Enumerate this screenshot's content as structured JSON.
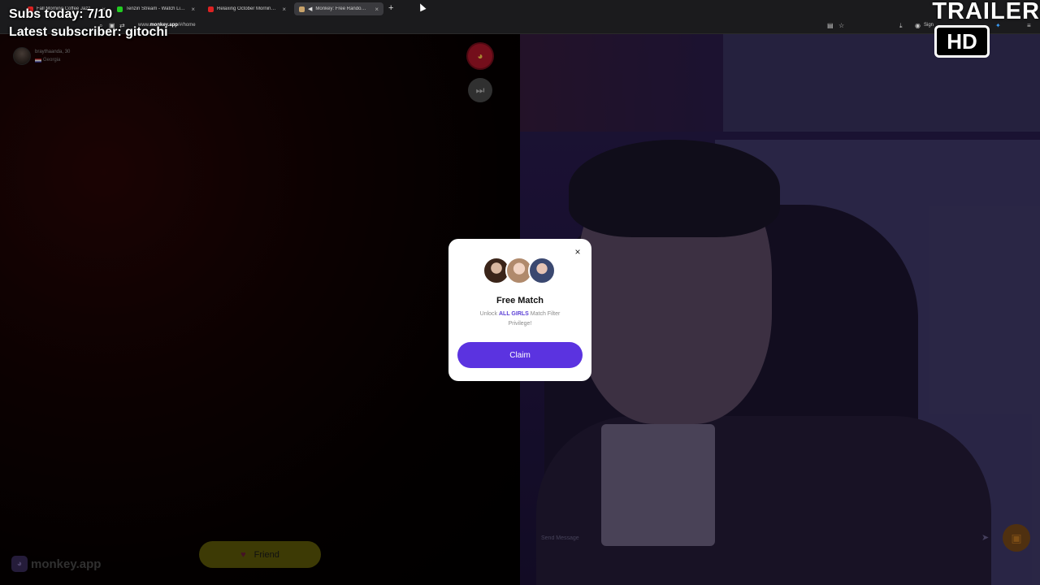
{
  "browser": {
    "tabs": [
      {
        "title": "Fall Morning Coffee Jazz Music",
        "color": "#d22"
      },
      {
        "title": "Tenzin Stream - Watch Live on",
        "color": "#2c2"
      },
      {
        "title": "Relaxing October Morning Jazz",
        "color": "#d22"
      },
      {
        "title": "Monkey: Free Random Vid-",
        "color": "#c9a36a"
      }
    ],
    "new_tab": "+",
    "close_glyph": "×",
    "url_host": "monkey.app",
    "url_path": "/#/home",
    "url_prefix": "www.",
    "sign_in": "Sign"
  },
  "overlay": {
    "subs": "Subs today: 7/10",
    "latest": "Latest subscriber: gitochi",
    "trailer": "TRAILER",
    "hd": "HD"
  },
  "partner": {
    "name": "braythaanda, 30",
    "location": "Georgia"
  },
  "app": {
    "brand": "monkey.app",
    "friend_label": "Friend",
    "message_placeholder": "Send Message"
  },
  "modal": {
    "title": "Free Match",
    "desc_prefix": "Unlock ",
    "desc_highlight": "ALL GIRLS",
    "desc_suffix": " Match Filter Privilege!",
    "claim_label": "Claim",
    "close_glyph": "×"
  },
  "colors": {
    "accent": "#5b33e0",
    "friend_button": "#5e5a08"
  }
}
